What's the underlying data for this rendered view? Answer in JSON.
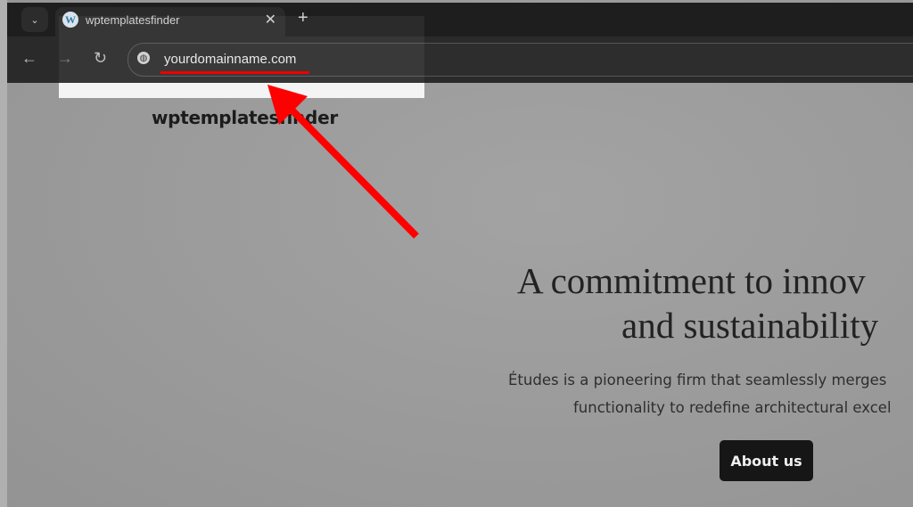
{
  "browser": {
    "tab_title": "wptemplatesfinder",
    "url": "yourdomainname.com",
    "icons": {
      "tab_menu": "chevron-down-icon",
      "favicon": "wordpress-icon",
      "close": "close-icon",
      "new_tab": "plus-icon",
      "back": "arrow-left-icon",
      "forward": "arrow-right-icon",
      "reload": "reload-icon",
      "site_info": "globe-icon"
    }
  },
  "page": {
    "site_title": "wptemplatesfinder",
    "heading_lines": [
      "A commitment to innov",
      "and sustainability"
    ],
    "description_lines": [
      "Études is a pioneering firm that seamlessly merges",
      "functionality to redefine architectural excel"
    ],
    "button_label": "About us"
  },
  "annotation": {
    "color": "#ff0000",
    "type": "arrow-and-underline"
  }
}
